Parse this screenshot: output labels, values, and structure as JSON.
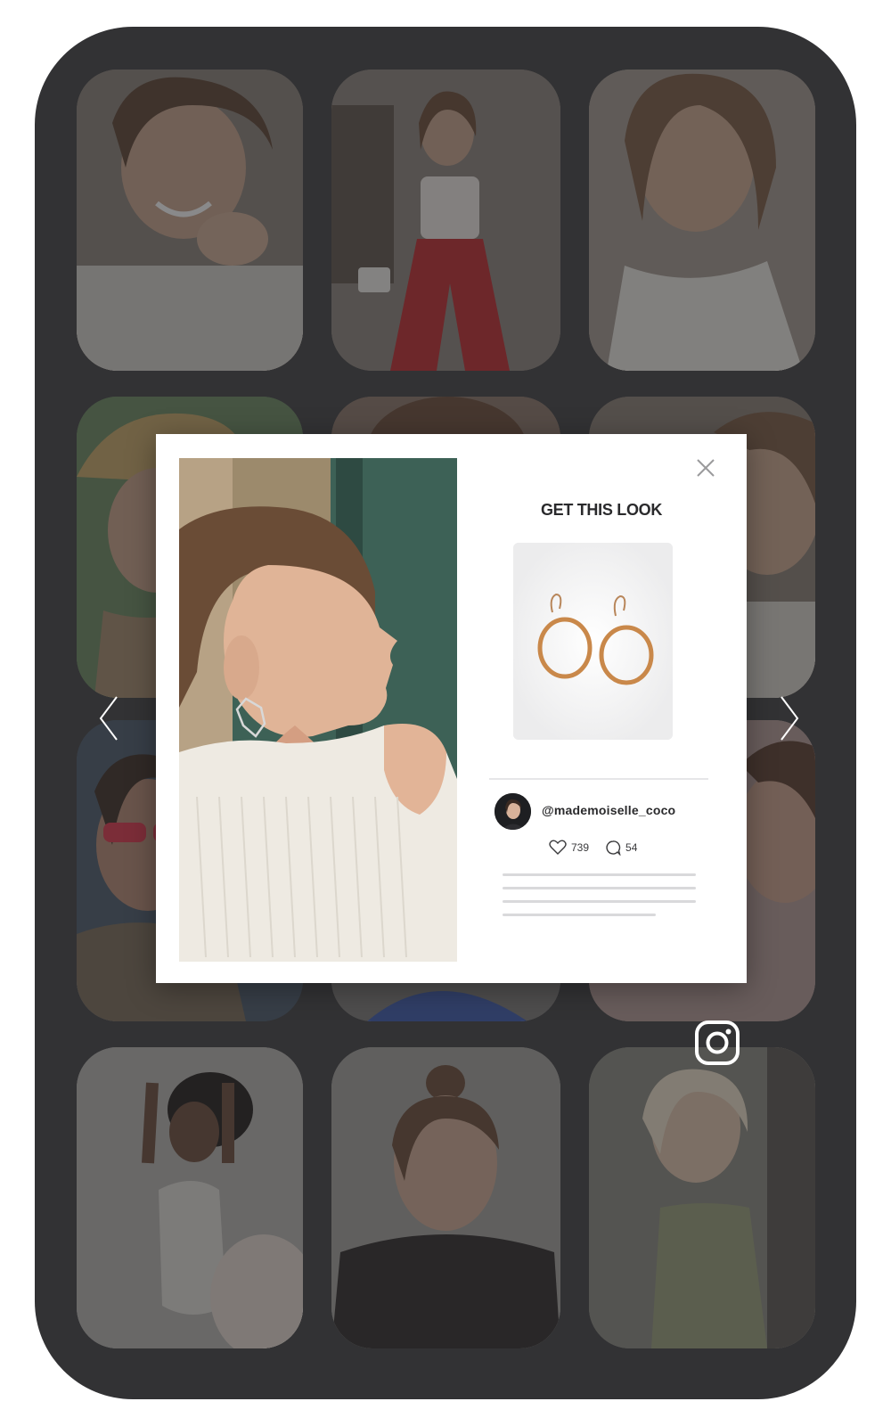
{
  "modal": {
    "title": "GET THIS LOOK",
    "close_icon": "close-icon",
    "product": {
      "icon": "earrings-image"
    },
    "author": {
      "handle": "@mademoiselle_coco"
    },
    "stats": {
      "likes": "739",
      "comments": "54",
      "likes_icon": "heart-icon",
      "comments_icon": "comment-icon"
    }
  },
  "navigation": {
    "prev_icon": "chevron-left-icon",
    "next_icon": "chevron-right-icon"
  },
  "brand": {
    "badge_icon": "instagram-icon"
  },
  "colors": {
    "frame": "#323234",
    "modal_bg": "#ffffff",
    "title_text": "#2a2a2c",
    "divider": "#e6e6e8",
    "caption_placeholder": "#d9d9db",
    "icon_white": "#ffffff"
  }
}
